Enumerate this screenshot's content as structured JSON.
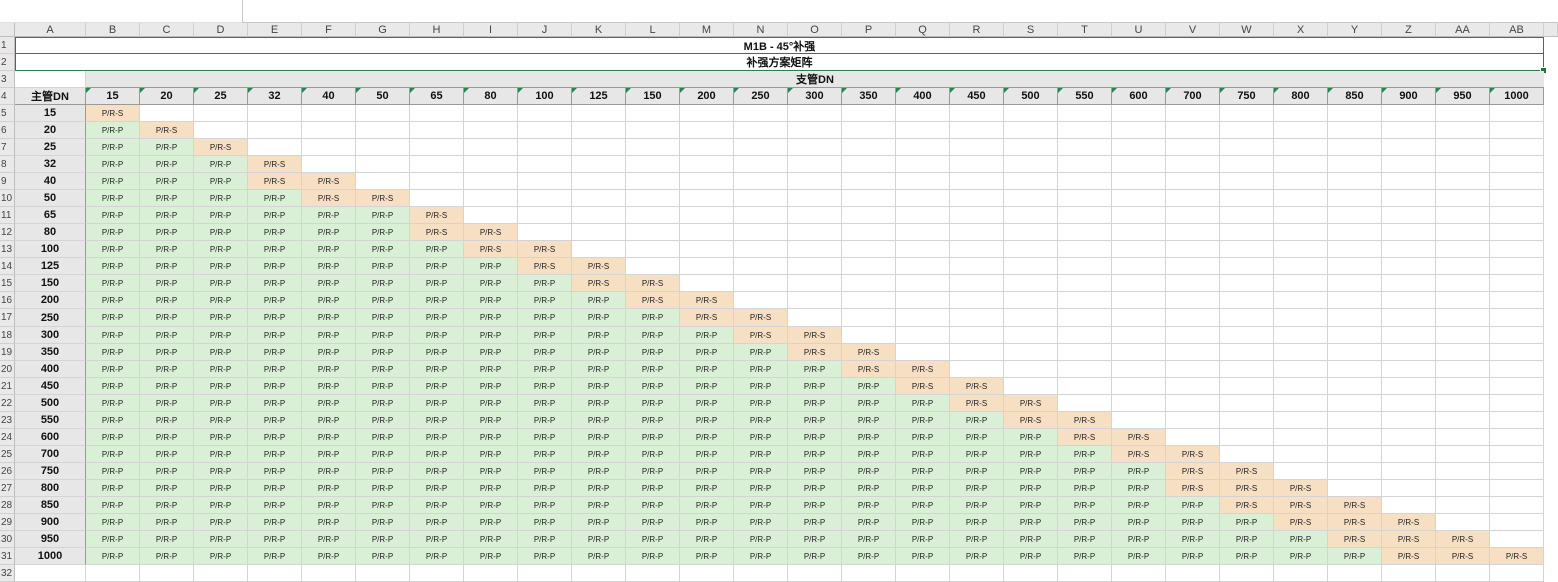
{
  "columns": [
    "A",
    "B",
    "C",
    "D",
    "E",
    "F",
    "G",
    "H",
    "I",
    "J",
    "K",
    "L",
    "M",
    "N",
    "O",
    "P",
    "Q",
    "R",
    "S",
    "T",
    "U",
    "V",
    "W",
    "X",
    "Y",
    "Z",
    "AA",
    "AB"
  ],
  "rows": [
    "1",
    "2",
    "3",
    "4",
    "5",
    "6",
    "7",
    "8",
    "9",
    "10",
    "11",
    "12",
    "13",
    "14",
    "15",
    "16",
    "17",
    "18",
    "19",
    "20",
    "21",
    "22",
    "23",
    "24",
    "25",
    "26",
    "27",
    "28",
    "29",
    "30",
    "31",
    "32"
  ],
  "title": "M1B - 45°补强",
  "subtitle": "补强方案矩阵",
  "branch_label": "支管DN",
  "main_label": "主管DN",
  "sizes": [
    "15",
    "20",
    "25",
    "32",
    "40",
    "50",
    "65",
    "80",
    "100",
    "125",
    "150",
    "200",
    "250",
    "300",
    "350",
    "400",
    "450",
    "500",
    "550",
    "600",
    "700",
    "750",
    "800",
    "850",
    "900",
    "950",
    "1000"
  ],
  "cell_pp": "P/R-P",
  "cell_ps": "P/R-S",
  "colors": {
    "pp": "#d9f0d6",
    "ps": "#f7dfc4",
    "header": "#e7e7e7",
    "selection": "#2e7d4f"
  }
}
